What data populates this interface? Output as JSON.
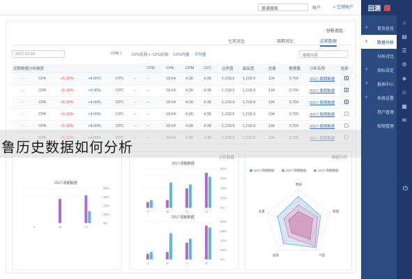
{
  "topbar": {
    "search_value": "普通搜索",
    "user_label": "账户",
    "logout_label": "< 注销账户"
  },
  "sidebar": {
    "brand": "回测",
    "items": [
      {
        "label": "首页总览",
        "arrow": "<"
      },
      {
        "label": "数据分析",
        "arrow": "v"
      },
      {
        "label": "分析对比",
        "arrow": ""
      },
      {
        "label": "指标设定",
        "arrow": "<"
      },
      {
        "label": "报表中心",
        "arrow": "<"
      },
      {
        "label": "系统设置",
        "arrow": "<"
      },
      {
        "label": "用户管理",
        "arrow": ""
      },
      {
        "label": "权限管理",
        "arrow": ""
      }
    ],
    "icons": [
      "home-icon",
      "chart-icon",
      "list-icon",
      "gear-icon",
      "layers-icon",
      "user-icon",
      "calendar-icon",
      "mail-icon"
    ],
    "power_icon": "⏻"
  },
  "main": {
    "panel_title": "分析对比",
    "tabs": [
      "近期数据",
      "周期对比",
      "七天对比"
    ],
    "active_tab": 0,
    "date_value": "2017-01-16",
    "filters": [
      "平均值",
      "CPU均值",
      "CPU比较",
      "CPU比较 <",
      "CPA <"
    ],
    "search_placeholder": "搜索内容",
    "table": {
      "headers": [
        "选择",
        "分析名称",
        "数据量",
        "总量",
        "最高值",
        "比例值",
        "CPC",
        "CPM",
        "CPA",
        "CPR",
        "",
        "近期数据分析维度"
      ],
      "rows": [
        {
          "checked": true,
          "name": "2017-周期数据",
          "c1": "3,706",
          "c2": "134",
          "c3": "1,218.9",
          "c4": "4.38",
          "c5": "18.64",
          "c6": "--",
          "c7": "CPC",
          "c8": "+4.00%",
          "c9": "+5.10%",
          "c10": "CPA",
          "c11": "- -"
        },
        {
          "checked": true,
          "name": "2017-周期数据",
          "c1": "3,706",
          "c2": "134",
          "c3": "1,218.9",
          "c4": "4.38",
          "c5": "18.64",
          "c6": "--",
          "c7": "CPC",
          "c8": "+4.00%",
          "c9": "+5.10%",
          "c10": "CPA",
          "c11": "- -"
        },
        {
          "checked": true,
          "name": "2017-周期数据",
          "c1": "3,706",
          "c2": "134",
          "c3": "1,218.9",
          "c4": "4.38",
          "c5": "18.64",
          "c6": "--",
          "c7": "CPC",
          "c8": "+4.00%",
          "c9": "+5.10%",
          "c10": "CPA",
          "c11": "- -"
        },
        {
          "checked": false,
          "name": "2017-周期数据",
          "c1": "3,706",
          "c2": "134",
          "c3": "1,218.9",
          "c4": "4.38",
          "c5": "18.64",
          "c6": "--",
          "c7": "CPC",
          "c8": "+4.00%",
          "c9": "+5.10%",
          "c10": "CPA",
          "c11": "- -"
        },
        {
          "checked": false,
          "name": "2017-周期数据",
          "c1": "3,706",
          "c2": "134",
          "c3": "1,218.9",
          "c4": "4.38",
          "c5": "18.64",
          "c6": "--",
          "c7": "CPC",
          "c8": "+4.00%",
          "c9": "+5.10%",
          "c10": "CPA",
          "c11": "- -"
        },
        {
          "checked": false,
          "name": "2017-周期数据",
          "c1": "3,706",
          "c2": "134",
          "c3": "1,218.9",
          "c4": "4.38",
          "c5": "18.64",
          "c6": "--",
          "c7": "CPC",
          "c8": "+4.00%",
          "c9": "+5.10%",
          "c10": "CPA",
          "c11": "- -"
        }
      ]
    }
  },
  "banner": {
    "text": "鲁历史数据如何分析"
  },
  "cards": {
    "left_title": "分析数据",
    "mid_title": "分析数据",
    "right_title": "数据分析"
  },
  "chart_data": [
    {
      "type": "bar",
      "title": "2017-周期数据",
      "categories": [
        "A",
        "B",
        "C"
      ],
      "series": [
        {
          "name": "purple",
          "values": [
            0,
            28,
            32
          ]
        },
        {
          "name": "cyan",
          "values": [
            0,
            0,
            14
          ]
        }
      ],
      "ylim": [
        0,
        40
      ],
      "tick_labels": [
        "0%",
        "10%",
        "20%",
        "30%",
        "40%"
      ]
    },
    {
      "type": "bar",
      "title": "2017-周期数据",
      "categories": [
        "A",
        "B",
        "C",
        "D"
      ],
      "series": [
        {
          "name": "purple",
          "values": [
            6,
            8,
            20,
            36
          ]
        },
        {
          "name": "cyan",
          "values": [
            8,
            26,
            24,
            32
          ]
        }
      ],
      "ylim": [
        0,
        40
      ],
      "tick_labels": [
        "0%",
        "10%",
        "20%",
        "30%",
        "40%"
      ]
    },
    {
      "type": "bar",
      "title": "2017-周期数据",
      "categories": [
        "A",
        "B",
        "C",
        "D"
      ],
      "series": [
        {
          "name": "purple",
          "values": [
            6,
            8,
            18,
            36
          ]
        },
        {
          "name": "cyan",
          "values": [
            8,
            28,
            22,
            34
          ]
        }
      ],
      "ylim": [
        0,
        40
      ],
      "tick_labels": [
        "0%",
        "10%",
        "20%",
        "30%",
        "40%"
      ]
    },
    {
      "type": "radar",
      "legend": [
        "2017-周期数据",
        "2017-周期数据",
        "2017-周期数据"
      ],
      "axes": [
        "数据",
        "数量",
        "下载",
        "结果",
        "总量"
      ],
      "series": [
        {
          "name": "blue",
          "values": [
            80,
            70,
            90,
            75,
            65
          ]
        },
        {
          "name": "pink",
          "values": [
            55,
            60,
            85,
            50,
            45
          ]
        },
        {
          "name": "fill",
          "values": [
            35,
            45,
            60,
            35,
            30
          ]
        }
      ],
      "max": 100
    }
  ]
}
